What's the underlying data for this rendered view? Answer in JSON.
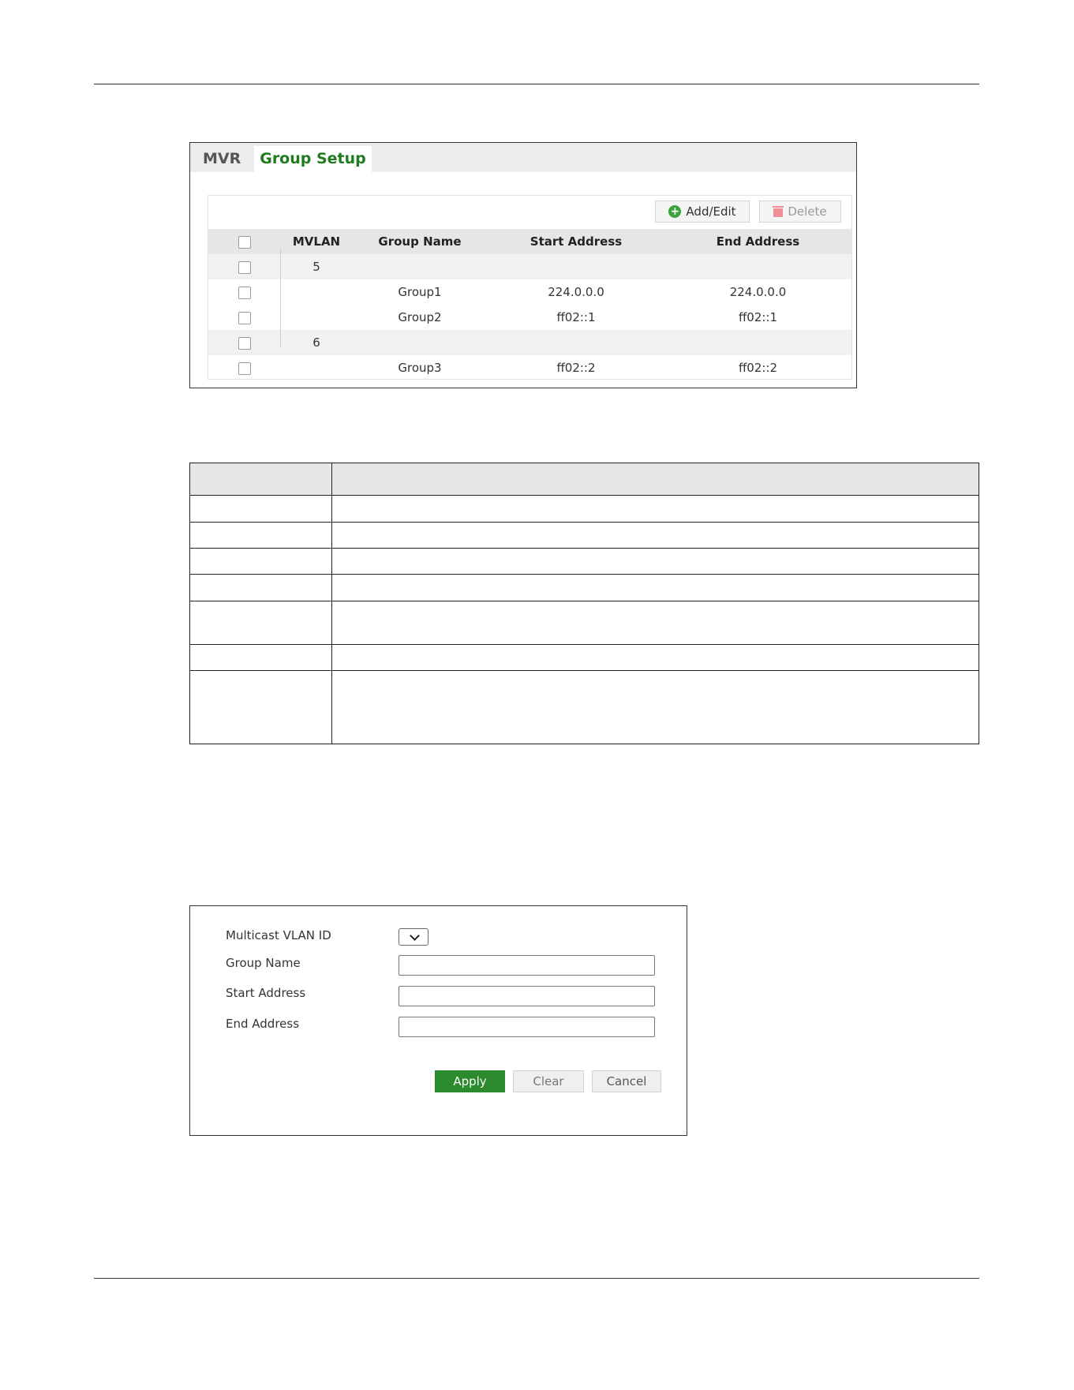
{
  "group_setup": {
    "tabs": [
      {
        "label": "MVR",
        "active": false
      },
      {
        "label": "Group Setup",
        "active": true
      }
    ],
    "add_edit_label": "Add/Edit",
    "delete_label": "Delete",
    "columns": {
      "mvlan": "MVLAN",
      "group_name": "Group Name",
      "start_address": "Start Address",
      "end_address": "End Address"
    },
    "rows": [
      {
        "type": "vlan",
        "mvlan": "5",
        "group_name": "",
        "start_address": "",
        "end_address": ""
      },
      {
        "type": "group",
        "mvlan": "",
        "group_name": "Group1",
        "start_address": "224.0.0.0",
        "end_address": "224.0.0.0"
      },
      {
        "type": "group",
        "mvlan": "",
        "group_name": "Group2",
        "start_address": "ff02::1",
        "end_address": "ff02::1"
      },
      {
        "type": "vlan",
        "mvlan": "6",
        "group_name": "",
        "start_address": "",
        "end_address": ""
      },
      {
        "type": "group",
        "mvlan": "",
        "group_name": "Group3",
        "start_address": "ff02::2",
        "end_address": "ff02::2"
      }
    ],
    "colors": {
      "active_tab": "#1e7b1e",
      "add_icon": "#3aa33a",
      "delete_icon": "#f08e98"
    }
  },
  "add_edit_form": {
    "multicast_vlan_id_label": "Multicast VLAN ID",
    "group_name_label": "Group Name",
    "start_address_label": "Start Address",
    "end_address_label": "End Address",
    "apply_label": "Apply",
    "clear_label": "Clear",
    "cancel_label": "Cancel",
    "colors": {
      "apply": "#2b8a2b"
    }
  }
}
